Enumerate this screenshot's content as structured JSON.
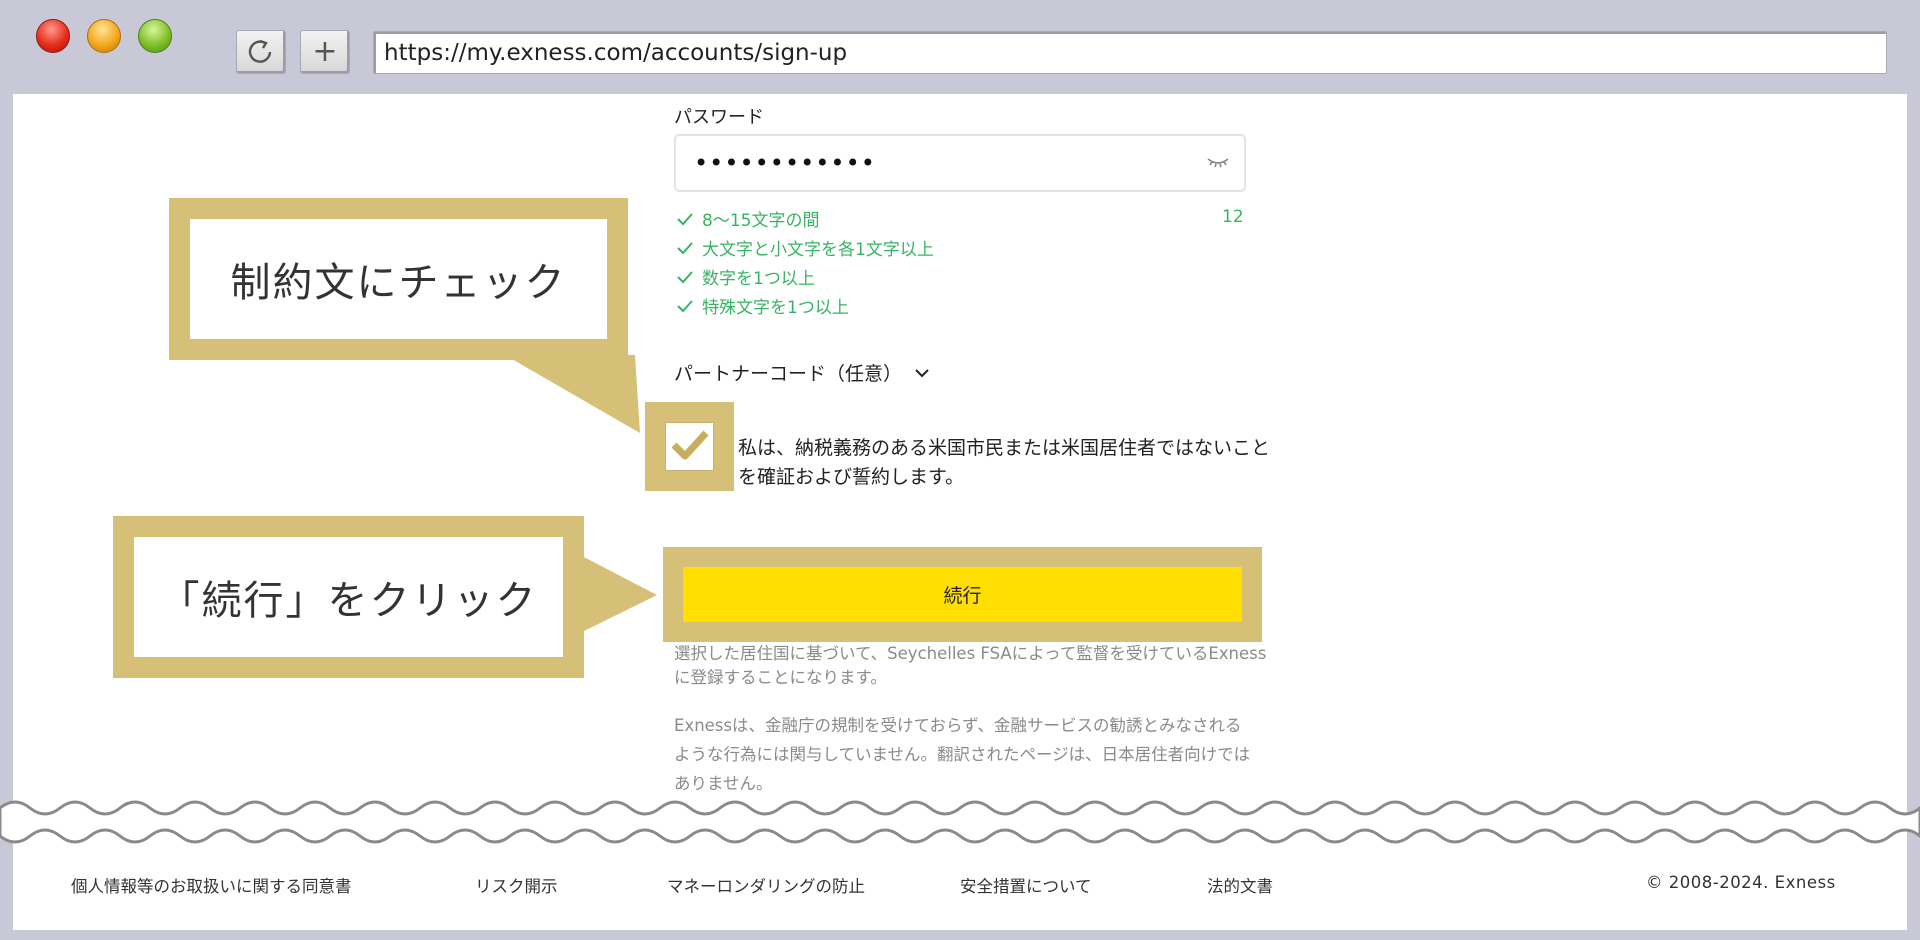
{
  "browser": {
    "url": "https://my.exness.com/accounts/sign-up",
    "new_tab_label": "+"
  },
  "form": {
    "password_label": "パスワード",
    "password_value": "••••••••••••",
    "rules": [
      "8～15文字の間",
      "大文字と小文字を各1文字以上",
      "数字を1つ以上",
      "特殊文字を1つ以上"
    ],
    "char_count": "12",
    "partner_code_label": "パートナーコード（任意）",
    "declaration_text": "私は、納税義務のある米国市民または米国居住者ではないことを確証および誓約します。",
    "declaration_checked": true,
    "continue_label": "続行",
    "notice_regulator": "選択した居住国に基づいて、Seychelles FSAによって監督を受けているExnessに登録することになります。",
    "notice_japan": "Exnessは、金融庁の規制を受けておらず、金融サービスの勧誘とみなされるような行為には関与していません。翻訳されたページは、日本居住者向けではありません。"
  },
  "callouts": {
    "check": "制約文にチェック",
    "continue": "「続行」をクリック"
  },
  "footer": {
    "links": [
      "個人情報等のお取扱いに関する同意書",
      "リスク開示",
      "マネーロンダリングの防止",
      "安全措置について",
      "法的文書"
    ],
    "copyright": "© 2008-2024. Exness"
  },
  "colors": {
    "accent_yellow": "#ffde00",
    "callout_gold": "#d6bf76",
    "success_green": "#37b463",
    "chrome_bg": "#c9c8d6"
  }
}
